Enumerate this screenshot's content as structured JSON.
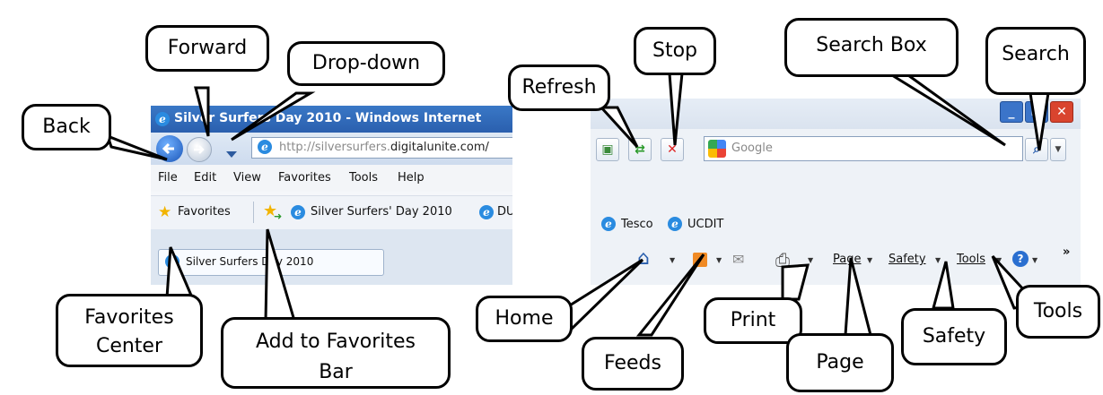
{
  "left_window": {
    "title": "Silver Surfers Day 2010 - Windows Internet",
    "url_plain": "http://silversurfers.",
    "url_domain": "digitalunite.com/",
    "menu": [
      "File",
      "Edit",
      "View",
      "Favorites",
      "Tools",
      "Help"
    ],
    "favorites_label": "Favorites",
    "fav_links": [
      "Silver Surfers' Day 2010",
      "DU"
    ],
    "tab_title": "Silver Surfers Day 2010"
  },
  "right_window": {
    "search_placeholder": "Google",
    "links": [
      "Tesco",
      "UCDIT"
    ],
    "page_menu": "Page",
    "safety_menu": "Safety",
    "tools_menu": "Tools",
    "chevrons": "»"
  },
  "callouts": {
    "back": "Back",
    "forward": "Forward",
    "dropdown": "Drop-down",
    "refresh": "Refresh",
    "stop": "Stop",
    "search_box": "Search Box",
    "search": "Search",
    "favorites_center_1": "Favorites",
    "favorites_center_2": "Center",
    "add_to_favorites_1": "Add to Favorites",
    "add_to_favorites_2": "Bar",
    "home": "Home",
    "feeds": "Feeds",
    "print": "Print",
    "page": "Page",
    "safety": "Safety",
    "tools": "Tools"
  },
  "colors": {
    "titlebar": "#2a5fae",
    "close_button": "#d9442e",
    "nav_button": "#2c6fd1"
  }
}
